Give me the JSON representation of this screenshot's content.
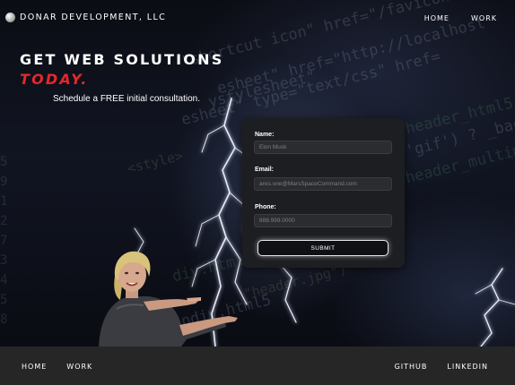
{
  "header": {
    "brand": "Donar Development, LLC",
    "nav": [
      "Home",
      "Work"
    ]
  },
  "hero": {
    "headline": "Get Web Solutions",
    "headline_accent": "Today.",
    "subline": "Schedule a FREE initial consultation.",
    "code_fragments": [
      "\"shortcut icon\" href=\"/favicon",
      "esheet\" href=\"http://localhost",
      "esheet\" type=\"text/css\" href=",
      "ystylesheet\"",
      "<style>",
      "header_html5(",
      "'gif') ? _background",
      "header_multimedia(",
      "div.html5(",
      "\"header.jpg\")",
      "ndiv.html5"
    ]
  },
  "form": {
    "fields": [
      {
        "label": "Name:",
        "placeholder": "Elon Musk"
      },
      {
        "label": "Email:",
        "placeholder": "ares.one@MarsSpaceCommand.com"
      },
      {
        "label": "Phone:",
        "placeholder": "888.999.0000"
      }
    ],
    "submit_label": "Submit"
  },
  "footer": {
    "left_links": [
      "Home",
      "Work"
    ],
    "right_links": [
      "Github",
      "LinkedIn"
    ]
  },
  "colors": {
    "accent": "#e5282a",
    "footer_bg": "#262626",
    "form_bg": "#1d1e21"
  }
}
